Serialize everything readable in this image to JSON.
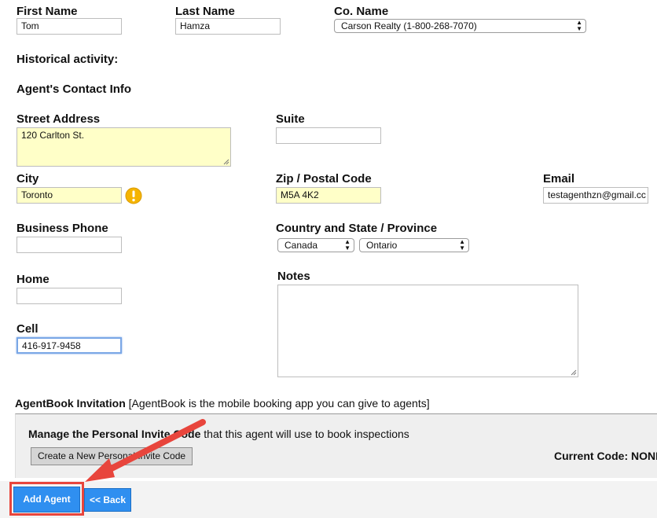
{
  "form": {
    "first_name": {
      "label": "First Name",
      "value": "Tom"
    },
    "last_name": {
      "label": "Last Name",
      "value": "Hamza"
    },
    "company": {
      "label": "Co. Name",
      "selected": "Carson Realty (1-800-268-7070)"
    },
    "historical_activity": "Historical activity:",
    "contact_heading": "Agent's Contact Info",
    "street": {
      "label": "Street Address",
      "value": "120 Carlton St."
    },
    "suite": {
      "label": "Suite",
      "value": ""
    },
    "city": {
      "label": "City",
      "value": "Toronto"
    },
    "zip": {
      "label": "Zip / Postal Code",
      "value": "M5A 4K2"
    },
    "email": {
      "label": "Email",
      "value": "testagenthzn@gmail.cc"
    },
    "business_phone": {
      "label": "Business Phone",
      "value": ""
    },
    "country_state": {
      "label": "Country and State / Province",
      "country": "Canada",
      "province": "Ontario"
    },
    "home": {
      "label": "Home",
      "value": ""
    },
    "notes": {
      "label": "Notes",
      "value": ""
    },
    "cell": {
      "label": "Cell",
      "value": "416-917-9458"
    }
  },
  "agentbook": {
    "title": "AgentBook Invitation",
    "description": "[AgentBook is the mobile booking app you can give to agents]",
    "manage_bold": "Manage the Personal Invite Code",
    "manage_rest": " that this agent will use to book inspections",
    "create_button": "Create a New Personal Invite Code",
    "current_code_label": "Current Code:",
    "current_code_value": "NONE"
  },
  "footer": {
    "add_agent": "Add Agent",
    "back": "<< Back"
  },
  "icons": {
    "warning": "warning-icon",
    "annotation": "arrow-annotation"
  },
  "colors": {
    "autofill_yellow": "#ffffc8",
    "button_blue": "#2f8ff0",
    "highlight_red": "#e8453c",
    "warning_gold": "#f5b400"
  }
}
